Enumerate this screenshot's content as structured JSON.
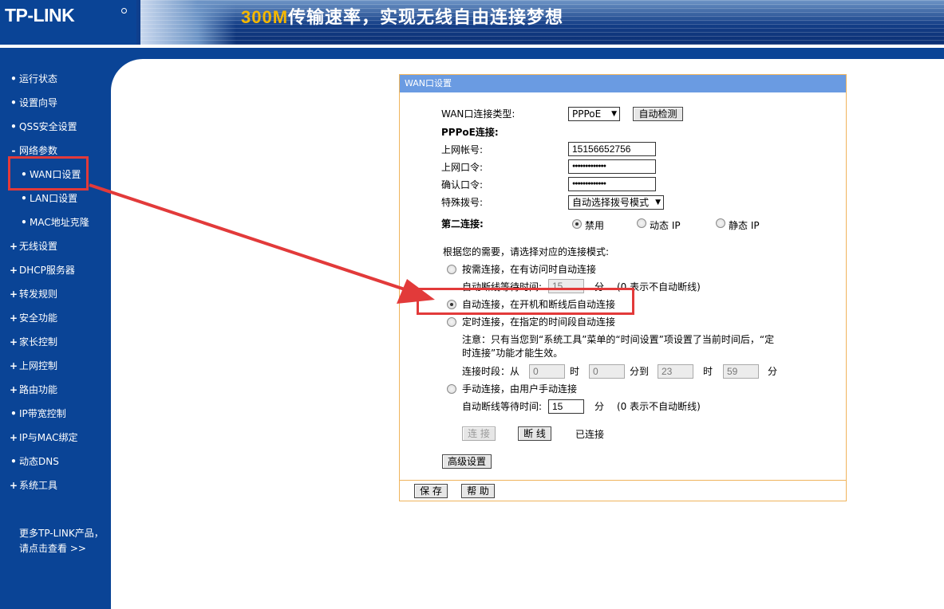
{
  "header": {
    "logo": "TP-LINK",
    "slogan_number": "300M",
    "slogan_text": "传输速率，实现无线自由连接梦想"
  },
  "sidebar": {
    "items": [
      {
        "bullet": "•",
        "label": "运行状态"
      },
      {
        "bullet": "•",
        "label": "设置向导"
      },
      {
        "bullet": "•",
        "label": "QSS安全设置"
      },
      {
        "bullet": "-",
        "label": "网络参数"
      },
      {
        "bullet": "•",
        "label": "WAN口设置"
      },
      {
        "bullet": "•",
        "label": "LAN口设置"
      },
      {
        "bullet": "•",
        "label": "MAC地址克隆"
      },
      {
        "bullet": "+",
        "label": "无线设置"
      },
      {
        "bullet": "+",
        "label": "DHCP服务器"
      },
      {
        "bullet": "+",
        "label": "转发规则"
      },
      {
        "bullet": "+",
        "label": "安全功能"
      },
      {
        "bullet": "+",
        "label": "家长控制"
      },
      {
        "bullet": "+",
        "label": "上网控制"
      },
      {
        "bullet": "+",
        "label": "路由功能"
      },
      {
        "bullet": "•",
        "label": "IP带宽控制"
      },
      {
        "bullet": "+",
        "label": "IP与MAC绑定"
      },
      {
        "bullet": "•",
        "label": "动态DNS"
      },
      {
        "bullet": "+",
        "label": "系统工具"
      }
    ],
    "more_line1": "更多TP-LINK产品，",
    "more_line2": "请点击查看 >>"
  },
  "panel": {
    "title": "WAN口设置",
    "wan_type_label": "WAN口连接类型:",
    "wan_type_value": "PPPoE",
    "auto_detect_button": "自动检测",
    "pppoe_heading": "PPPoE连接:",
    "username_label": "上网帐号:",
    "username_value": "15156652756",
    "password_label": "上网口令:",
    "password_value": "●●●●●●●●●●●●●",
    "confirm_label": "确认口令:",
    "confirm_value": "●●●●●●●●●●●●●",
    "special_dial_label": "特殊拨号:",
    "special_dial_value": "自动选择拨号模式",
    "second_conn_label": "第二连接:",
    "second_conn_options": [
      "禁用",
      "动态 IP",
      "静态 IP"
    ],
    "mode_prompt": "根据您的需要，请选择对应的连接模式:",
    "mode_on_demand": "按需连接，在有访问时自动连接",
    "idle_time_label": "自动断线等待时间:",
    "idle_time_value": "15",
    "minutes": "分",
    "idle_hint": "(0 表示不自动断线)",
    "mode_auto": "自动连接，在开机和断线后自动连接",
    "mode_timed": "定时连接，在指定的时间段自动连接",
    "note_line1": "注意：只有当您到“系统工具”菜单的“时间设置”项设置了当前时间后，“定",
    "note_line2": "时连接”功能才能生效。",
    "period_label": "连接时段：从",
    "period_from_hour": "0",
    "hour_unit": "时",
    "period_from_min": "0",
    "min_to": "分到",
    "period_to_hour": "23",
    "period_to_min": "59",
    "mode_manual": "手动连接，由用户手动连接",
    "manual_idle_value": "15",
    "connect_button": "连 接",
    "disconnect_button": "断 线",
    "status_text": "已连接",
    "advanced_button": "高级设置",
    "save_button": "保 存",
    "help_button": "帮 助"
  },
  "colors": {
    "brand_blue": "#0a4496",
    "panel_title": "#6a9be2",
    "annotation_red": "#e23a3a",
    "panel_border": "#f0b45c"
  }
}
